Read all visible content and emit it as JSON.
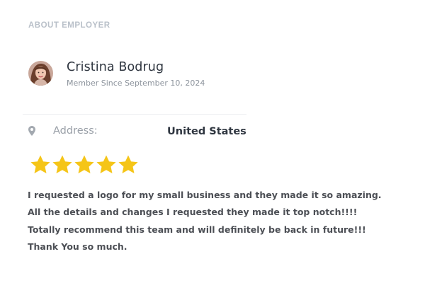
{
  "section": {
    "title": "ABOUT EMPLOYER"
  },
  "employer": {
    "name": "Cristina Bodrug",
    "member_since": "Member Since September 10, 2024",
    "avatar_icon": "user-avatar-photo"
  },
  "address": {
    "icon": "map-pin-icon",
    "label": "Address:",
    "value": "United States"
  },
  "rating": {
    "stars": 5,
    "max": 5,
    "star_color": "#f5c518"
  },
  "review": {
    "lines": [
      "I requested a logo for my small business and they made it so amazing.",
      "All the details and changes I requested they made it top notch!!!!",
      "Totally recommend this team and will definitely be back in future!!!",
      "Thank You so much."
    ]
  },
  "colors": {
    "heading": "#2f3640",
    "muted": "#b9c0c9",
    "body_text": "#4c4f55"
  }
}
